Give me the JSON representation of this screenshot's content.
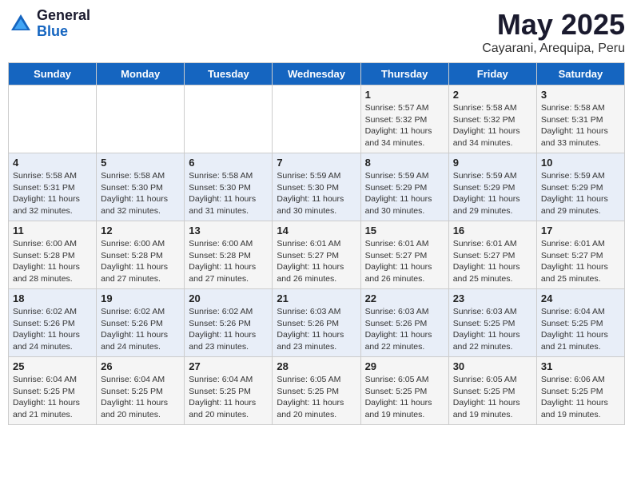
{
  "header": {
    "logo_general": "General",
    "logo_blue": "Blue",
    "month": "May 2025",
    "location": "Cayarani, Arequipa, Peru"
  },
  "days_of_week": [
    "Sunday",
    "Monday",
    "Tuesday",
    "Wednesday",
    "Thursday",
    "Friday",
    "Saturday"
  ],
  "weeks": [
    [
      {
        "day": "",
        "info": ""
      },
      {
        "day": "",
        "info": ""
      },
      {
        "day": "",
        "info": ""
      },
      {
        "day": "",
        "info": ""
      },
      {
        "day": "1",
        "info": "Sunrise: 5:57 AM\nSunset: 5:32 PM\nDaylight: 11 hours\nand 34 minutes."
      },
      {
        "day": "2",
        "info": "Sunrise: 5:58 AM\nSunset: 5:32 PM\nDaylight: 11 hours\nand 34 minutes."
      },
      {
        "day": "3",
        "info": "Sunrise: 5:58 AM\nSunset: 5:31 PM\nDaylight: 11 hours\nand 33 minutes."
      }
    ],
    [
      {
        "day": "4",
        "info": "Sunrise: 5:58 AM\nSunset: 5:31 PM\nDaylight: 11 hours\nand 32 minutes."
      },
      {
        "day": "5",
        "info": "Sunrise: 5:58 AM\nSunset: 5:30 PM\nDaylight: 11 hours\nand 32 minutes."
      },
      {
        "day": "6",
        "info": "Sunrise: 5:58 AM\nSunset: 5:30 PM\nDaylight: 11 hours\nand 31 minutes."
      },
      {
        "day": "7",
        "info": "Sunrise: 5:59 AM\nSunset: 5:30 PM\nDaylight: 11 hours\nand 30 minutes."
      },
      {
        "day": "8",
        "info": "Sunrise: 5:59 AM\nSunset: 5:29 PM\nDaylight: 11 hours\nand 30 minutes."
      },
      {
        "day": "9",
        "info": "Sunrise: 5:59 AM\nSunset: 5:29 PM\nDaylight: 11 hours\nand 29 minutes."
      },
      {
        "day": "10",
        "info": "Sunrise: 5:59 AM\nSunset: 5:29 PM\nDaylight: 11 hours\nand 29 minutes."
      }
    ],
    [
      {
        "day": "11",
        "info": "Sunrise: 6:00 AM\nSunset: 5:28 PM\nDaylight: 11 hours\nand 28 minutes."
      },
      {
        "day": "12",
        "info": "Sunrise: 6:00 AM\nSunset: 5:28 PM\nDaylight: 11 hours\nand 27 minutes."
      },
      {
        "day": "13",
        "info": "Sunrise: 6:00 AM\nSunset: 5:28 PM\nDaylight: 11 hours\nand 27 minutes."
      },
      {
        "day": "14",
        "info": "Sunrise: 6:01 AM\nSunset: 5:27 PM\nDaylight: 11 hours\nand 26 minutes."
      },
      {
        "day": "15",
        "info": "Sunrise: 6:01 AM\nSunset: 5:27 PM\nDaylight: 11 hours\nand 26 minutes."
      },
      {
        "day": "16",
        "info": "Sunrise: 6:01 AM\nSunset: 5:27 PM\nDaylight: 11 hours\nand 25 minutes."
      },
      {
        "day": "17",
        "info": "Sunrise: 6:01 AM\nSunset: 5:27 PM\nDaylight: 11 hours\nand 25 minutes."
      }
    ],
    [
      {
        "day": "18",
        "info": "Sunrise: 6:02 AM\nSunset: 5:26 PM\nDaylight: 11 hours\nand 24 minutes."
      },
      {
        "day": "19",
        "info": "Sunrise: 6:02 AM\nSunset: 5:26 PM\nDaylight: 11 hours\nand 24 minutes."
      },
      {
        "day": "20",
        "info": "Sunrise: 6:02 AM\nSunset: 5:26 PM\nDaylight: 11 hours\nand 23 minutes."
      },
      {
        "day": "21",
        "info": "Sunrise: 6:03 AM\nSunset: 5:26 PM\nDaylight: 11 hours\nand 23 minutes."
      },
      {
        "day": "22",
        "info": "Sunrise: 6:03 AM\nSunset: 5:26 PM\nDaylight: 11 hours\nand 22 minutes."
      },
      {
        "day": "23",
        "info": "Sunrise: 6:03 AM\nSunset: 5:25 PM\nDaylight: 11 hours\nand 22 minutes."
      },
      {
        "day": "24",
        "info": "Sunrise: 6:04 AM\nSunset: 5:25 PM\nDaylight: 11 hours\nand 21 minutes."
      }
    ],
    [
      {
        "day": "25",
        "info": "Sunrise: 6:04 AM\nSunset: 5:25 PM\nDaylight: 11 hours\nand 21 minutes."
      },
      {
        "day": "26",
        "info": "Sunrise: 6:04 AM\nSunset: 5:25 PM\nDaylight: 11 hours\nand 20 minutes."
      },
      {
        "day": "27",
        "info": "Sunrise: 6:04 AM\nSunset: 5:25 PM\nDaylight: 11 hours\nand 20 minutes."
      },
      {
        "day": "28",
        "info": "Sunrise: 6:05 AM\nSunset: 5:25 PM\nDaylight: 11 hours\nand 20 minutes."
      },
      {
        "day": "29",
        "info": "Sunrise: 6:05 AM\nSunset: 5:25 PM\nDaylight: 11 hours\nand 19 minutes."
      },
      {
        "day": "30",
        "info": "Sunrise: 6:05 AM\nSunset: 5:25 PM\nDaylight: 11 hours\nand 19 minutes."
      },
      {
        "day": "31",
        "info": "Sunrise: 6:06 AM\nSunset: 5:25 PM\nDaylight: 11 hours\nand 19 minutes."
      }
    ]
  ]
}
